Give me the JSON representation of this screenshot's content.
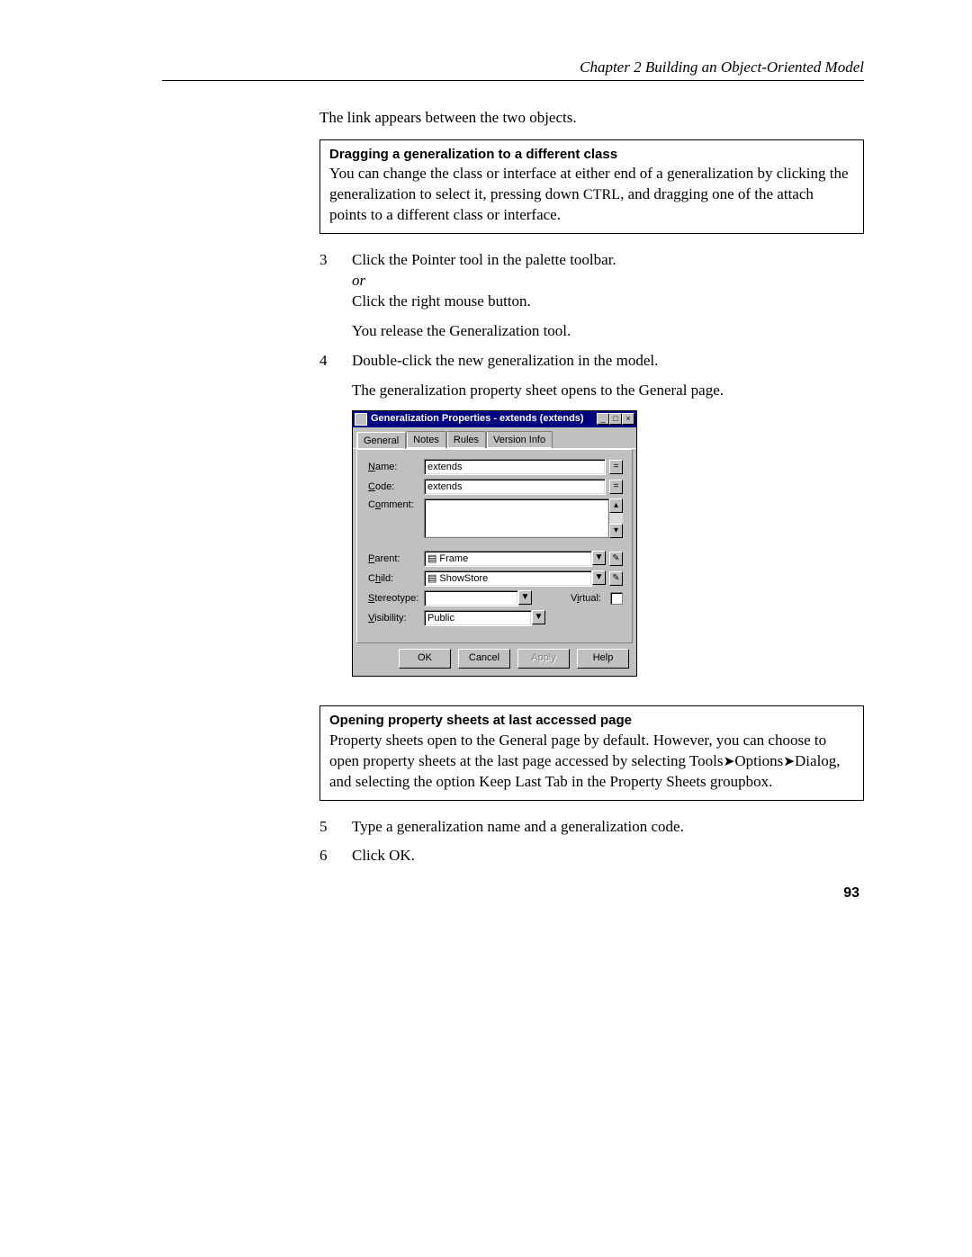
{
  "header": "Chapter 2   Building an Object-Oriented Model",
  "p_link": "The link appears between the two objects.",
  "note1": {
    "title": "Dragging a generalization to a different class",
    "body_a": "You can change the class or interface at either end of a generalization by clicking the generalization to select it, pressing down ",
    "ctrl": "CTRL",
    "body_b": ", and dragging one of the attach points to a different class or interface."
  },
  "step3": {
    "num": "3",
    "line1": "Click the Pointer tool in the palette toolbar.",
    "or": "or",
    "line2": "Click the right mouse button.",
    "follow": "You release the Generalization tool."
  },
  "step4": {
    "num": "4",
    "line1": "Double-click the new generalization in the model.",
    "follow": "The generalization property sheet opens to the General page."
  },
  "dialog": {
    "title": "Generalization Properties - extends (extends)",
    "winbtns": {
      "min": "_",
      "max": "□",
      "close": "×"
    },
    "tabs": [
      "General",
      "Notes",
      "Rules",
      "Version Info"
    ],
    "labels": {
      "name": "Name:",
      "nameU": "N",
      "code": "Code:",
      "codeU": "C",
      "comment": "Comment:",
      "commentU": "o",
      "parent": "Parent:",
      "parentU": "P",
      "child": "Child:",
      "childU": "h",
      "stereo": "Stereotype:",
      "stereoU": "S",
      "virtual": "Virtual:",
      "virtualU": "i",
      "vis": "Visibility:",
      "visU": "V"
    },
    "values": {
      "name": "extends",
      "code": "extends",
      "parent": "Frame",
      "child": "ShowStore",
      "stereo": "",
      "vis": "Public"
    },
    "buttons": {
      "ok": "OK",
      "cancel": "Cancel",
      "apply": "Apply",
      "help": "Help"
    },
    "glyphs": {
      "eq": "=",
      "drop": "▼",
      "prop": "✎",
      "up": "▴",
      "dn": "▾"
    }
  },
  "note2": {
    "title": "Opening property sheets at last accessed page",
    "l1": "Property sheets open to the General page by default. However, you can choose to open property sheets at the last page accessed by selecting Tools",
    "arrow": "➤",
    "l2": "Options",
    "l3": "Dialog, and selecting the option Keep Last Tab in the Property Sheets groupbox."
  },
  "step5": {
    "num": "5",
    "text": "Type a generalization name and a generalization code."
  },
  "step6": {
    "num": "6",
    "text": "Click OK."
  },
  "pagenum": "93"
}
